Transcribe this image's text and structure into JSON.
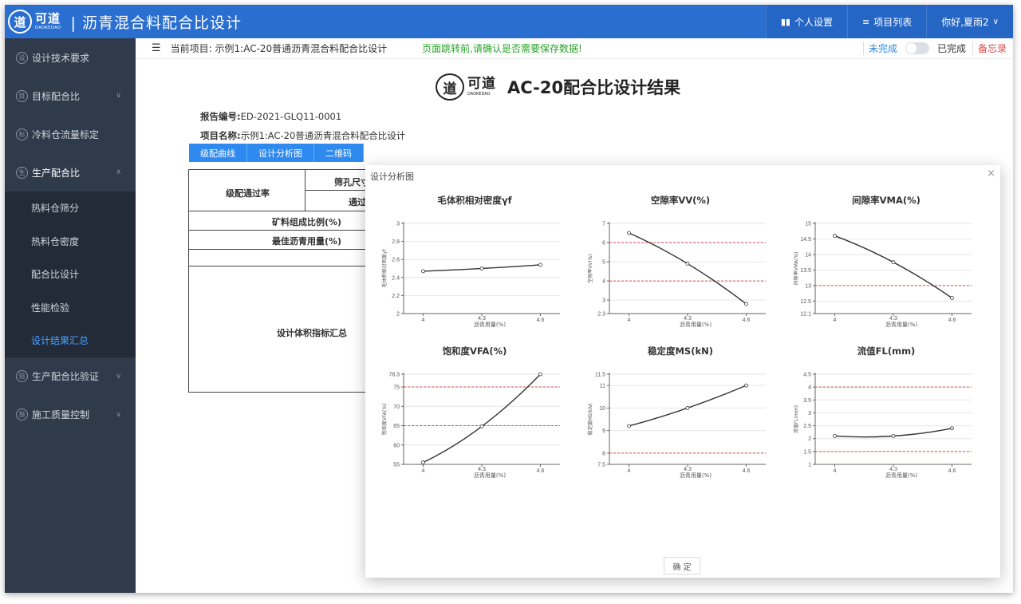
{
  "header": {
    "logo_mark": "道",
    "logo_cn": "可道",
    "logo_en": "DAOKEDAO",
    "app_title": "| 沥青混合料配合比设计",
    "personal_settings": "个人设置",
    "project_list": "项目列表",
    "greeting": "你好,夏雨2",
    "greeting_caret": "∨"
  },
  "sidebar": {
    "items": [
      {
        "icon": "设",
        "label": "设计技术要求",
        "caret": ""
      },
      {
        "icon": "目",
        "label": "目标配合比",
        "caret": "∨"
      },
      {
        "icon": "标",
        "label": "冷料仓流量标定",
        "caret": ""
      },
      {
        "icon": "生",
        "label": "生产配合比",
        "caret": "∧"
      }
    ],
    "subitems": [
      "热料仓筛分",
      "热料仓密度",
      "配合比设计",
      "性能检验",
      "设计结果汇总"
    ],
    "items_after": [
      {
        "icon": "验",
        "label": "生产配合比验证",
        "caret": "∨"
      },
      {
        "icon": "施",
        "label": "施工质量控制",
        "caret": "∨"
      }
    ]
  },
  "subheader": {
    "menu_icon": "☰",
    "current_project": "当前项目: 示例1:AC-20普通沥青混合料配合比设计",
    "warning": "页面跳转前,请确认是否需要保存数据!",
    "undone": "未完成",
    "done": "已完成",
    "memo": "备忘录"
  },
  "report": {
    "title": "AC-20配合比设计结果",
    "report_no_label": "报告编号:",
    "report_no": "ED-2021-GLQ11-0001",
    "project_label": "项目名称:",
    "project_name": "示例1:AC-20普通沥青混合料配合比设计",
    "buttons": [
      "级配曲线",
      "设计分析图",
      "二维码"
    ],
    "table": {
      "grading_pass_rate": "级配通过率",
      "sieve_size": "筛孔尺寸",
      "pass": "通过",
      "mineral_ratio": "矿料组成比例(%)",
      "optimal_asphalt": "最佳沥青用量(%)",
      "volume_summary": "设计体积指标汇总"
    }
  },
  "modal": {
    "title": "设计分析图",
    "close": "×",
    "ok": "确 定"
  },
  "chart_data": [
    {
      "type": "line",
      "title": "毛体积相对密度γf",
      "xlabel": "沥青用量(%)",
      "ylabel": "毛体积相对密度γf",
      "x": [
        4,
        4.3,
        4.6
      ],
      "y": [
        2.47,
        2.5,
        2.54
      ],
      "ylim": [
        2,
        3
      ],
      "yticks": [
        "2",
        "2.2",
        "2.4",
        "2.6",
        "2.8",
        "3"
      ],
      "xticks": [
        "4",
        "4.3",
        "4.6"
      ],
      "limits": []
    },
    {
      "type": "line",
      "title": "空隙率VV(%)",
      "xlabel": "沥青用量(%)",
      "ylabel": "空隙率VV(%)",
      "x": [
        4,
        4.3,
        4.6
      ],
      "y": [
        6.5,
        4.9,
        2.8
      ],
      "ylim": [
        2.3,
        7
      ],
      "yticks": [
        "2.3",
        "3",
        "4",
        "5",
        "6",
        "7"
      ],
      "xticks": [
        "4",
        "4.3",
        "4.6"
      ],
      "limits": [
        6,
        4
      ]
    },
    {
      "type": "line",
      "title": "间隙率VMA(%)",
      "xlabel": "沥青用量(%)",
      "ylabel": "间隙率VMA(%)",
      "x": [
        4,
        4.3,
        4.6
      ],
      "y": [
        14.6,
        13.75,
        12.6
      ],
      "ylim": [
        12.1,
        15
      ],
      "yticks": [
        "12.1",
        "12.5",
        "13",
        "13.5",
        "14",
        "14.5",
        "15"
      ],
      "xticks": [
        "4",
        "4.3",
        "4.6"
      ],
      "limits": [
        13
      ]
    },
    {
      "type": "line",
      "title": "饱和度VFA(%)",
      "xlabel": "沥青用量(%)",
      "ylabel": "饱和度VFA(%)",
      "x": [
        4,
        4.3,
        4.6
      ],
      "y": [
        55.5,
        64.8,
        78.3
      ],
      "ylim": [
        55,
        78.3
      ],
      "yticks": [
        "55",
        "60",
        "65",
        "70",
        "75",
        "78.3"
      ],
      "xticks": [
        "4",
        "4.3",
        "4.6"
      ],
      "limits": [
        75,
        65
      ]
    },
    {
      "type": "line",
      "title": "稳定度MS(kN)",
      "xlabel": "沥青用量(%)",
      "ylabel": "稳定度MS(kN)",
      "x": [
        4,
        4.3,
        4.6
      ],
      "y": [
        9.2,
        10,
        11
      ],
      "ylim": [
        7.5,
        11.5
      ],
      "yticks": [
        "7.5",
        "8",
        "9",
        "10",
        "11",
        "11.5"
      ],
      "xticks": [
        "4",
        "4.3",
        "4.6"
      ],
      "limits": [
        8
      ]
    },
    {
      "type": "line",
      "title": "流值FL(mm)",
      "xlabel": "沥青用量(%)",
      "ylabel": "流值FL(mm)",
      "x": [
        4,
        4.3,
        4.6
      ],
      "y": [
        2.1,
        2.1,
        2.4
      ],
      "ylim": [
        1,
        4.5
      ],
      "yticks": [
        "1",
        "1.5",
        "2",
        "2.5",
        "3",
        "3.5",
        "4",
        "4.5"
      ],
      "xticks": [
        "4",
        "4.3",
        "4.6"
      ],
      "limits": [
        4,
        1.5
      ]
    }
  ],
  "colors": {
    "brand": "#2a6fd0",
    "sidebar": "#2f3a4a",
    "limit_line": "#e04a4a",
    "warning": "#28a428",
    "active": "#4aa0ff"
  }
}
